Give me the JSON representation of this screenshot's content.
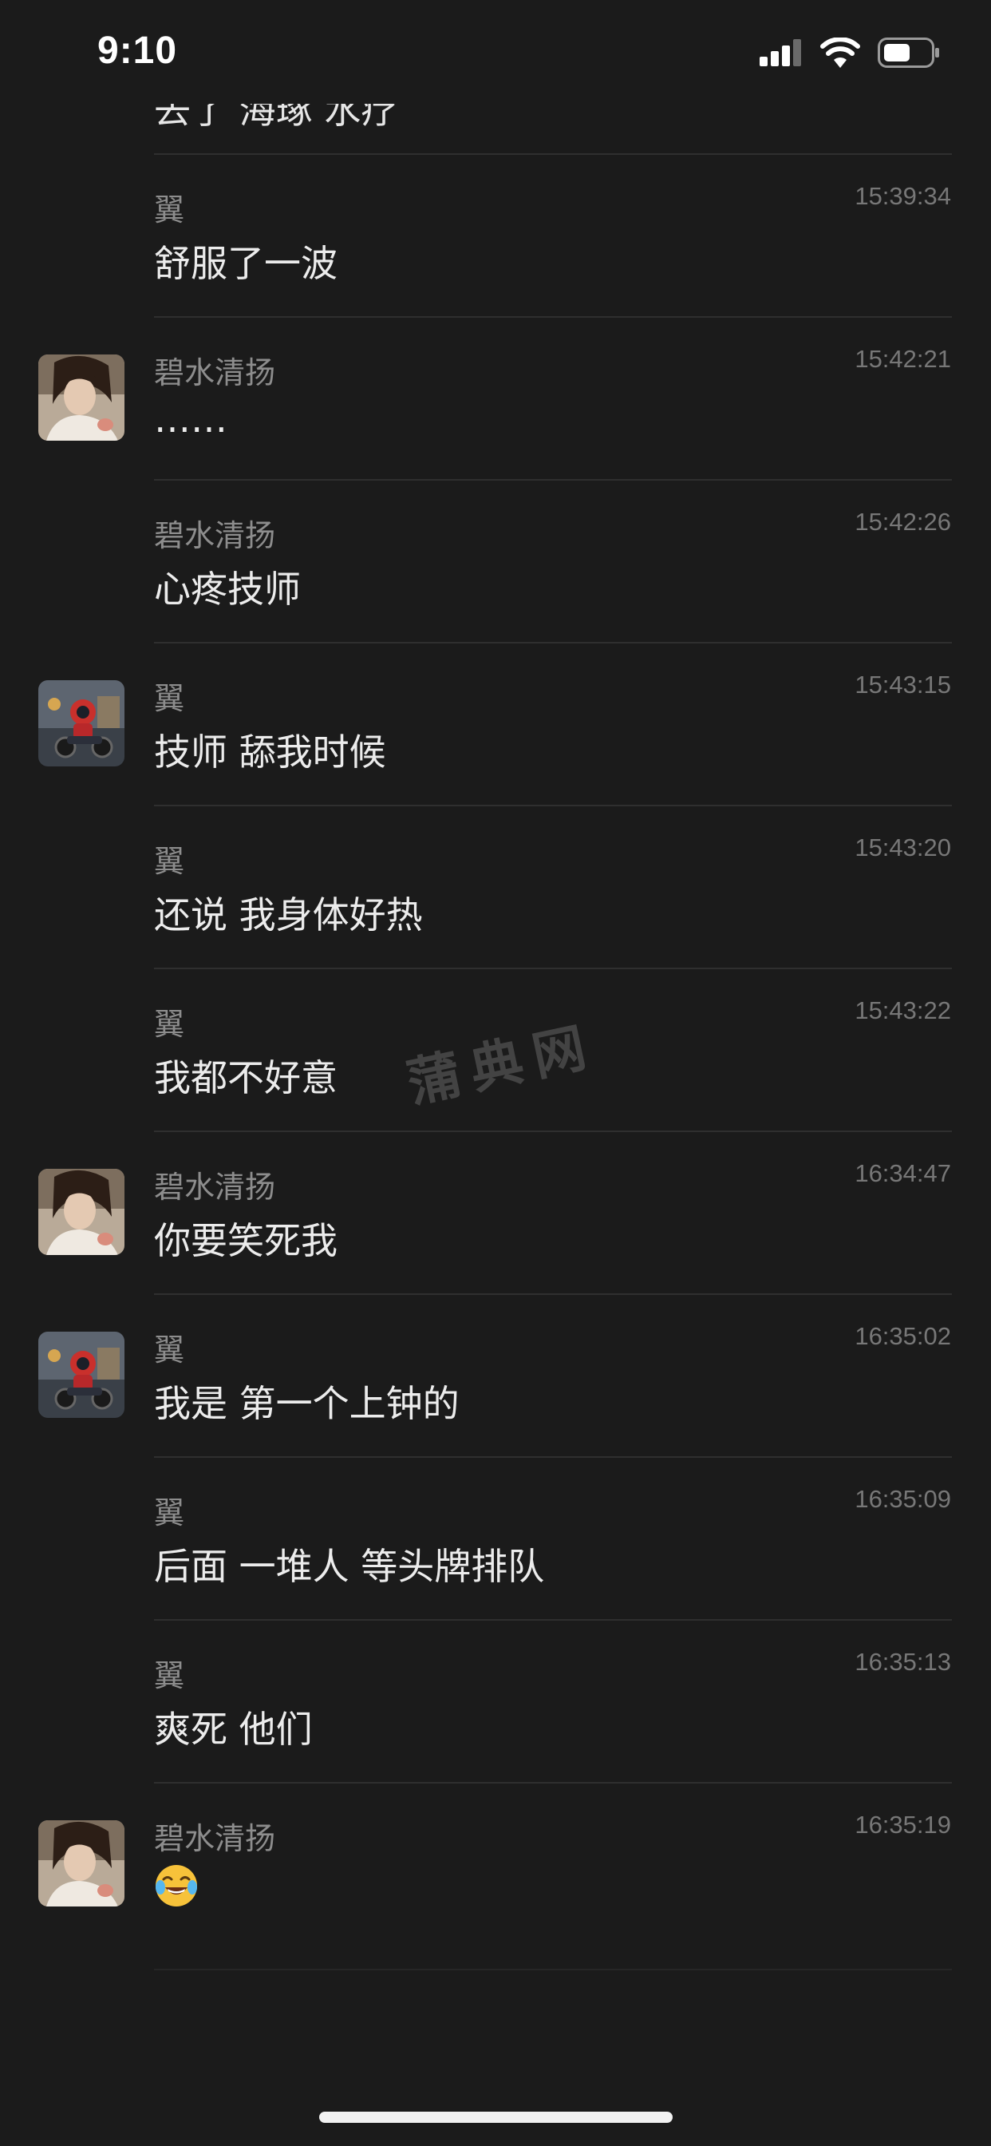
{
  "status_bar": {
    "time": "9:10"
  },
  "icons": {
    "signal": "cellular-signal-icon",
    "wifi": "wifi-icon",
    "battery": "battery-icon",
    "laugh_emoji": "face-with-tears-of-joy-emoji"
  },
  "chat": {
    "partial_top_text": "去了 海琢 水疗",
    "messages": [
      {
        "sender": "翼",
        "time": "15:39:34",
        "text": "舒服了一波",
        "avatar": ""
      },
      {
        "sender": "碧水清扬",
        "time": "15:42:21",
        "text": "……",
        "avatar": "female-portrait"
      },
      {
        "sender": "碧水清扬",
        "time": "15:42:26",
        "text": "心疼技师",
        "avatar": ""
      },
      {
        "sender": "翼",
        "time": "15:43:15",
        "text": "技师 舔我时候",
        "avatar": "robot-motorcycle"
      },
      {
        "sender": "翼",
        "time": "15:43:20",
        "text": "还说 我身体好热",
        "avatar": ""
      },
      {
        "sender": "翼",
        "time": "15:43:22",
        "text": "我都不好意",
        "avatar": ""
      },
      {
        "sender": "碧水清扬",
        "time": "16:34:47",
        "text": "你要笑死我",
        "avatar": "female-portrait"
      },
      {
        "sender": "翼",
        "time": "16:35:02",
        "text": "我是 第一个上钟的",
        "avatar": "robot-motorcycle"
      },
      {
        "sender": "翼",
        "time": "16:35:09",
        "text": "后面 一堆人 等头牌排队",
        "avatar": ""
      },
      {
        "sender": "翼",
        "time": "16:35:13",
        "text": "爽死 他们",
        "avatar": ""
      },
      {
        "sender": "碧水清扬",
        "time": "16:35:19",
        "text": "",
        "emoji": "face-with-tears-of-joy-emoji",
        "avatar": "female-portrait"
      }
    ]
  },
  "watermark": "蒲典网",
  "colors": {
    "background": "#1b1b1b",
    "text_primary": "#ececec",
    "text_secondary": "#8d8d8d",
    "timestamp": "#777777",
    "divider": "#2f2f2f"
  }
}
